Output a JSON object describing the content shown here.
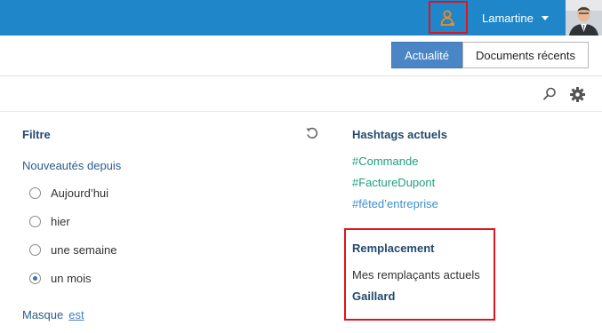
{
  "header": {
    "user_name": "Lamartine",
    "icons": [
      "deputy-user-icon",
      "chevron-down-icon",
      "avatar"
    ],
    "colors": {
      "bar": "#1f86c9",
      "highlight": "#e0141e",
      "deputy_icon": "#f28a1f"
    }
  },
  "tabs": [
    {
      "label": "Actualité",
      "active": true
    },
    {
      "label": "Documents récents",
      "active": false
    }
  ],
  "toolbar": {
    "icons": [
      "search-icon",
      "gear-icon"
    ]
  },
  "filter": {
    "title": "Filtre",
    "since_label": "Nouveautés depuis",
    "options": [
      {
        "label": "Aujourd’hui",
        "checked": false
      },
      {
        "label": "hier",
        "checked": false
      },
      {
        "label": "une semaine",
        "checked": false
      },
      {
        "label": "un mois",
        "checked": true
      }
    ],
    "mask_label": "Masque",
    "mask_link": "est"
  },
  "hashtags": {
    "title": "Hashtags actuels",
    "items": [
      {
        "label": "#Commande",
        "color": "#1e9f7f"
      },
      {
        "label": "#FactureDupont",
        "color": "#1e9f7f"
      },
      {
        "label": "#fêted’entreprise",
        "color": "#3c8fd0"
      }
    ]
  },
  "replacement": {
    "title": "Remplacement",
    "label": "Mes remplaçants actuels",
    "name": "Gaillard"
  }
}
